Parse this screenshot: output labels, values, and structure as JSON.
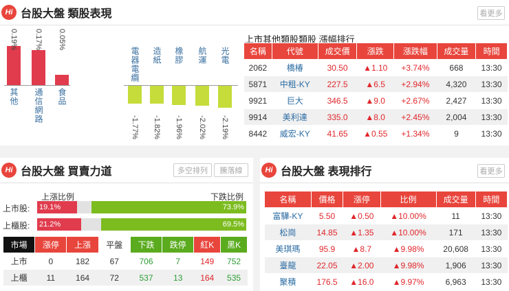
{
  "sector": {
    "title": "台股大盤 類股表現",
    "more": "看更多",
    "up_bars": [
      {
        "name": "其他",
        "pct": "0.19%",
        "value": 0.19
      },
      {
        "name": "通信網路",
        "pct": "0.17%",
        "value": 0.17
      },
      {
        "name": "食品",
        "pct": "0.05%",
        "value": 0.05
      }
    ],
    "down_bars": [
      {
        "name": "電器電纜",
        "pct": "-1.77%",
        "value": -1.77
      },
      {
        "name": "造紙",
        "pct": "-1.82%",
        "value": -1.82
      },
      {
        "name": "橡膠",
        "pct": "-1.96%",
        "value": -1.96
      },
      {
        "name": "航運",
        "pct": "-2.02%",
        "value": -2.02
      },
      {
        "name": "光電",
        "pct": "-2.19%",
        "value": -2.19
      }
    ],
    "table_title": "上市其他類股類股 漲幅排行",
    "headers": [
      "名稱",
      "代號",
      "成交價",
      "漲跌",
      "漲跌幅",
      "成交量",
      "時間"
    ],
    "rows": [
      [
        "2062",
        "橋椿",
        "30.50",
        "▲1.10",
        "+3.74%",
        "668",
        "13:30"
      ],
      [
        "5871",
        "中租-KY",
        "227.5",
        "▲6.5",
        "+2.94%",
        "4,320",
        "13:30"
      ],
      [
        "9921",
        "巨大",
        "346.5",
        "▲9.0",
        "+2.67%",
        "2,427",
        "13:30"
      ],
      [
        "9914",
        "美利達",
        "335.0",
        "▲8.0",
        "+2.45%",
        "2,004",
        "13:30"
      ],
      [
        "8442",
        "威宏-KY",
        "41.65",
        "▲0.55",
        "+1.34%",
        "9",
        "13:30"
      ]
    ]
  },
  "power": {
    "title": "台股大盤 買賣力道",
    "btn1": "多空排列",
    "btn2": "騰落線",
    "up_label": "上漲比例",
    "down_label": "下跌比例",
    "rows": [
      {
        "name": "上市股:",
        "up": "19.1%",
        "up_value": 19.1,
        "down": "73.9%",
        "down_value": 73.9
      },
      {
        "name": "上櫃股:",
        "up": "21.2%",
        "up_value": 21.2,
        "down": "69.5%",
        "down_value": 69.5
      }
    ],
    "headers": [
      "市場",
      "漲停",
      "上漲",
      "平盤",
      "下跌",
      "跌停",
      "紅K",
      "黑K"
    ],
    "stats": [
      [
        "上市",
        "0",
        "182",
        "67",
        "706",
        "7",
        "149",
        "752"
      ],
      [
        "上櫃",
        "11",
        "164",
        "72",
        "537",
        "13",
        "164",
        "535"
      ]
    ]
  },
  "ranking": {
    "title": "台股大盤 表現排行",
    "more": "看更多",
    "headers": [
      "名稱",
      "價格",
      "漲停",
      "比例",
      "成交量",
      "時間"
    ],
    "rows": [
      [
        "富驊-KY",
        "5.50",
        "▲0.50",
        "▲10.00%",
        "11",
        "13:30"
      ],
      [
        "松崗",
        "14.85",
        "▲1.35",
        "▲10.00%",
        "171",
        "13:30"
      ],
      [
        "美琪瑪",
        "95.9",
        "▲8.7",
        "▲9.98%",
        "20,608",
        "13:30"
      ],
      [
        "臺龍",
        "22.05",
        "▲2.00",
        "▲9.98%",
        "1,906",
        "13:30"
      ],
      [
        "聚積",
        "176.5",
        "▲16.0",
        "▲9.97%",
        "6,963",
        "13:30"
      ]
    ]
  },
  "colors": {
    "red": "#e8453c",
    "green": "#c5dc3a",
    "bar_red": "#e03c4d",
    "bar_green": "#7cbc1f"
  }
}
